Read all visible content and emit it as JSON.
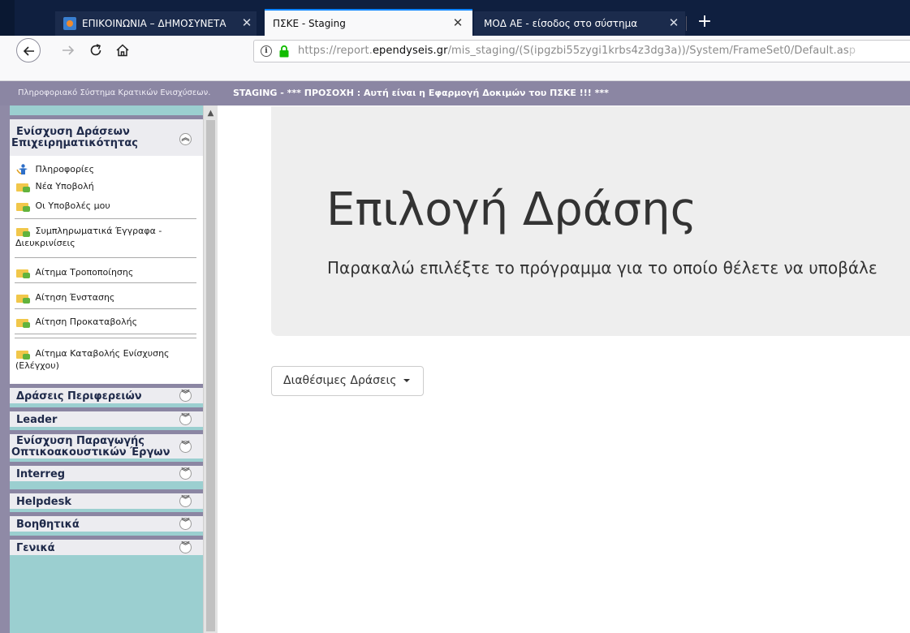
{
  "browser": {
    "tabs": [
      {
        "title": "ΕΠΙΚΟΙΝΩΝΙΑ – ΔΗΜΟΣΥΝΕΤΑ",
        "active": false
      },
      {
        "title": "ΠΣΚΕ - Staging",
        "active": true
      },
      {
        "title": "ΜΟΔ ΑΕ - είσοδος στο σύστημα",
        "active": false
      }
    ],
    "new_tab_label": "+",
    "close_glyph": "✕",
    "url": {
      "prefix": "https://report.",
      "domain": "ependyseis.gr",
      "path": "/mis_staging/(S(ipgzbi55zygi1krbs4z3dg3a))/System/FrameSet0/Default.as",
      "tail": "p"
    },
    "accent": "#0a84ff"
  },
  "banner": {
    "system_name": "Πληροφοριακό Σύστημα Κρατικών Ενισχύσεων.",
    "staging_notice": "STAGING - *** ΠΡΟΣΟΧΗ : Αυτή είναι η Εφαρμογή Δοκιμών του ΠΣΚΕ !!! ***",
    "color": "#8b86a3"
  },
  "sidebar": {
    "active_panel": {
      "title_line1": "Ενίσχυση Δράσεων",
      "title_line2": "Επιχειρηματικότητας",
      "items": [
        {
          "label": "Πληροφορίες",
          "icon": "info-person-icon"
        },
        {
          "label": "Νέα Υποβολή",
          "icon": "folder-icon"
        },
        {
          "label": "Οι Υποβολές μου",
          "icon": "folder-icon"
        },
        {
          "label": "Συμπληρωματικά Έγγραφα -",
          "label2": "Διευκρινίσεις",
          "icon": "folder-icon"
        },
        {
          "label": "Αίτημα Τροποποίησης",
          "icon": "folder-icon"
        },
        {
          "label": "Αίτηση Ένστασης",
          "icon": "folder-icon"
        },
        {
          "label": "Αίτηση Προκαταβολής",
          "icon": "folder-icon"
        },
        {
          "label": "Αίτημα Καταβολής Ενίσχυσης",
          "label2": "(Ελέγχου)",
          "icon": "folder-icon"
        }
      ]
    },
    "panels": [
      {
        "title": "Δράσεις Περιφερειών"
      },
      {
        "title": "Leader"
      },
      {
        "title": "Ενίσχυση Παραγωγής",
        "title2": "Οπτικοακουστικών Έργων"
      },
      {
        "title": "Interreg"
      },
      {
        "title": "Helpdesk"
      },
      {
        "title": "Βοηθητικά"
      },
      {
        "title": "Γενικά"
      }
    ],
    "collapse_glyph": "︽",
    "expand_glyph": "︾",
    "background": "#9bcfd0"
  },
  "main": {
    "title": "Επιλογή Δράσης",
    "subtitle": "Παρακαλώ επιλέξτε το πρόγραμμα για το οποίο θέλετε να υποβάλε",
    "dropdown_label": "Διαθέσιμες Δράσεις"
  }
}
